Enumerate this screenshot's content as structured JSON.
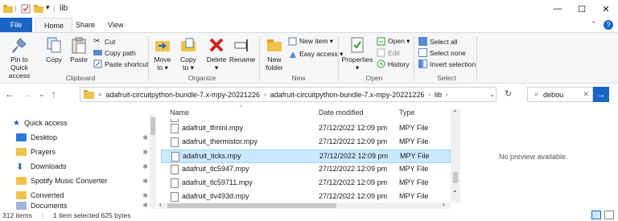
{
  "titlebar": {
    "title": "lib",
    "sep": "|",
    "minimize": "—",
    "maximize": "☐",
    "close": "✕"
  },
  "tabs": {
    "file": "File",
    "home": "Home",
    "share": "Share",
    "view": "View"
  },
  "ribbon": {
    "clipboard": {
      "pin": "Pin to Quick access",
      "copy": "Copy",
      "paste": "Paste",
      "cut": "Cut",
      "copy_path": "Copy path",
      "paste_shortcut": "Paste shortcut",
      "label": "Clipboard"
    },
    "organize": {
      "move_to": "Move to ▾",
      "copy_to": "Copy to ▾",
      "delete": "Delete ▾",
      "rename": "Rename",
      "label": "Organize"
    },
    "new": {
      "new_folder": "New folder",
      "new_item": "New item ▾",
      "easy_access": "Easy access ▾",
      "label": "New"
    },
    "open": {
      "properties": "Properties ▾",
      "open": "Open ▾",
      "edit": "Edit",
      "history": "History",
      "label": "Open"
    },
    "select": {
      "select_all": "Select all",
      "select_none": "Select none",
      "invert": "Invert selection",
      "label": "Select"
    }
  },
  "address": {
    "crumbs": [
      "«",
      "adafruit-circuitpython-bundle-7.x-mpy-20221226",
      "adafruit-circuitpython-bundle-7.x-mpy-20221226",
      "lib"
    ],
    "search_value": "debou"
  },
  "nav": [
    {
      "label": "Quick access",
      "icon": "star-icon"
    },
    {
      "label": "Desktop",
      "icon": "desktop-icon"
    },
    {
      "label": "Prayers",
      "icon": "folder-icon"
    },
    {
      "label": "Downloads",
      "icon": "download-icon"
    },
    {
      "label": "Spotify Music Converter",
      "icon": "folder-icon"
    },
    {
      "label": "Converted",
      "icon": "folder-icon"
    },
    {
      "label": "Documents",
      "icon": "documents-icon"
    }
  ],
  "columns": {
    "name": "Name",
    "date": "Date modified",
    "type": "Type"
  },
  "files": [
    {
      "name": "adafruit_tfmini.mpy",
      "date": "27/12/2022 12:09 pm",
      "type": "MPY File",
      "selected": false
    },
    {
      "name": "adafruit_thermistor.mpy",
      "date": "27/12/2022 12:09 pm",
      "type": "MPY File",
      "selected": false
    },
    {
      "name": "adafruit_ticks.mpy",
      "date": "27/12/2022 12:09 pm",
      "type": "MPY File",
      "selected": true
    },
    {
      "name": "adafruit_tlc5947.mpy",
      "date": "27/12/2022 12:09 pm",
      "type": "MPY File",
      "selected": false
    },
    {
      "name": "adafruit_tlc59711.mpy",
      "date": "27/12/2022 12:09 pm",
      "type": "MPY File",
      "selected": false
    },
    {
      "name": "adafruit_tlv493d.mpy",
      "date": "27/12/2022 12:09 pm",
      "type": "MPY File",
      "selected": false
    }
  ],
  "preview": "No preview available.",
  "status": {
    "count": "312 items",
    "selection": "1 item selected  625 bytes"
  },
  "colors": {
    "accent": "#1a64c6",
    "selection": "#cce8ff",
    "folder": "#f0c24b"
  }
}
